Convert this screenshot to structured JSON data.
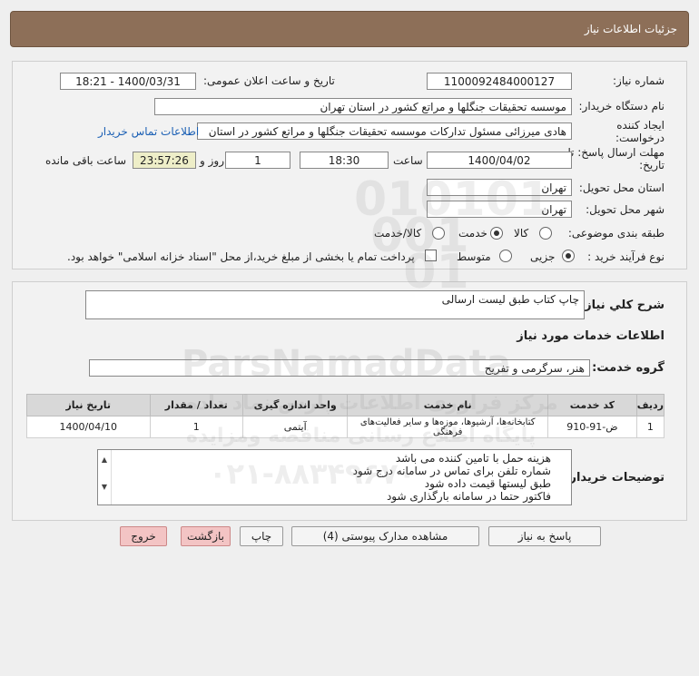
{
  "header": {
    "title": "جزئیات اطلاعات نیاز"
  },
  "form": {
    "need_number_label": "شماره نیاز:",
    "need_number": "1100092484000127",
    "announce_label": "تاریخ و ساعت اعلان عمومی:",
    "announce_value": "1400/03/31 - 18:21",
    "buyer_org_label": "نام دستگاه خریدار:",
    "buyer_org": "موسسه تحقیقات جنگلها و مراتع کشور در استان تهران",
    "creator_label": "ایجاد کننده درخواست:",
    "creator": "هادی میرزائی مسئول تدارکات موسسه تحقیقات جنگلها و مراتع کشور در استان",
    "contact_link": "اطلاعات تماس خریدار",
    "deadline_label": "مهلت ارسال پاسخ: تا تاریخ:",
    "deadline_date": "1400/04/02",
    "time_label": "ساعت",
    "deadline_time": "18:30",
    "days_value": "1",
    "days_label": "روز و",
    "countdown": "23:57:26",
    "remaining_label": "ساعت باقی مانده",
    "province_label": "استان محل تحویل:",
    "province": "تهران",
    "city_label": "شهر محل تحویل:",
    "city": "تهران",
    "category_label": "طبقه بندی موضوعی:",
    "category_options": [
      "کالا",
      "خدمت",
      "کالا/خدمت"
    ],
    "purchase_type_label": "نوع فرآیند خرید :",
    "purchase_options": [
      "جزیی",
      "متوسط"
    ],
    "payment_note": "پرداخت تمام یا بخشی از مبلغ خرید،از محل \"اسناد خزانه اسلامی\" خواهد بود."
  },
  "summary": {
    "title": "شرح کلي نياز:",
    "value": "چاپ کتاب طبق لیست ارسالی",
    "services_title": "اطلاعات خدمات مورد نياز",
    "group_label": "گروه خدمت:",
    "group_value": "هنر، سرگرمی و تفریح"
  },
  "table": {
    "headers": [
      "ردیف",
      "کد خدمت",
      "نام خدمت",
      "واحد اندازه گیری",
      "تعداد / مقدار",
      "تاریخ نیاز"
    ],
    "rows": [
      [
        "1",
        "ض-91-910",
        "کتابخانه‌ها، آرشیوها، موزه‌ها و سایر فعالیت‌های فرهنگی",
        "آیتمی",
        "1",
        "1400/04/10"
      ]
    ]
  },
  "notes": {
    "label": "توضیحات خریدار:",
    "lines": [
      "هزینه حمل با تامین کننده می باشد",
      "شماره تلفن برای تماس در سامانه درج شود",
      "طبق لیستها قیمت داده شود",
      "فاکتور حتما در سامانه بارگذاری شود"
    ]
  },
  "buttons": {
    "reply": "پاسخ به نیاز",
    "docs": "مشاهده مدارک پیوستی (4)",
    "print": "چاپ",
    "back": "بازگشت",
    "exit": "خروج"
  },
  "watermark": {
    "brand": "ParsNamadData",
    "line1": "مرکز فراوری اطلاعات پارس نماد داده",
    "line2": "پایگاه اطلاع رسانی مناقصه ومزایده",
    "phone": "۰۲۱-۸۸۳۴۹۶۷۰"
  },
  "colors": {
    "header": "#8d6f58",
    "countdown_bg": "#eeeec8",
    "link": "#1a5fb4",
    "danger_btn": "#f3c4c4"
  }
}
